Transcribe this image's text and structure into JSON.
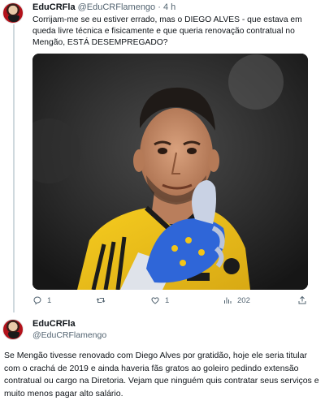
{
  "tweet1": {
    "author_name": "EduCRFla",
    "author_handle": "@EduCRFlamengo",
    "separator": "·",
    "time": "4 h",
    "text": "Corrijam-me se eu estiver errado, mas o DIEGO ALVES - que estava em queda livre técnica e fisicamente e que queria renovação contratual no Mengão, ESTÁ DESEMPREGADO?",
    "image_icon": "photo-goalkeeper",
    "actions": {
      "reply_count": "1",
      "retweet_count": "",
      "like_count": "1",
      "views_count": "202"
    }
  },
  "tweet2": {
    "author_name": "EduCRFla",
    "author_handle": "@EduCRFlamengo",
    "text": "Se Mengão tivesse renovado com Diego Alves por gratidão, hoje ele seria titular com o crachá de 2019 e ainda haveria fãs gratos ao goleiro pedindo extensão contratual ou cargo na Diretoria. Vejam que ninguém quis contratar seus serviços e muito menos pagar alto salário."
  },
  "colors": {
    "text": "#0f1419",
    "muted": "#536471",
    "thread_line": "#cfd9de",
    "jersey": "#f2c418",
    "glove": "#2f66d8"
  }
}
